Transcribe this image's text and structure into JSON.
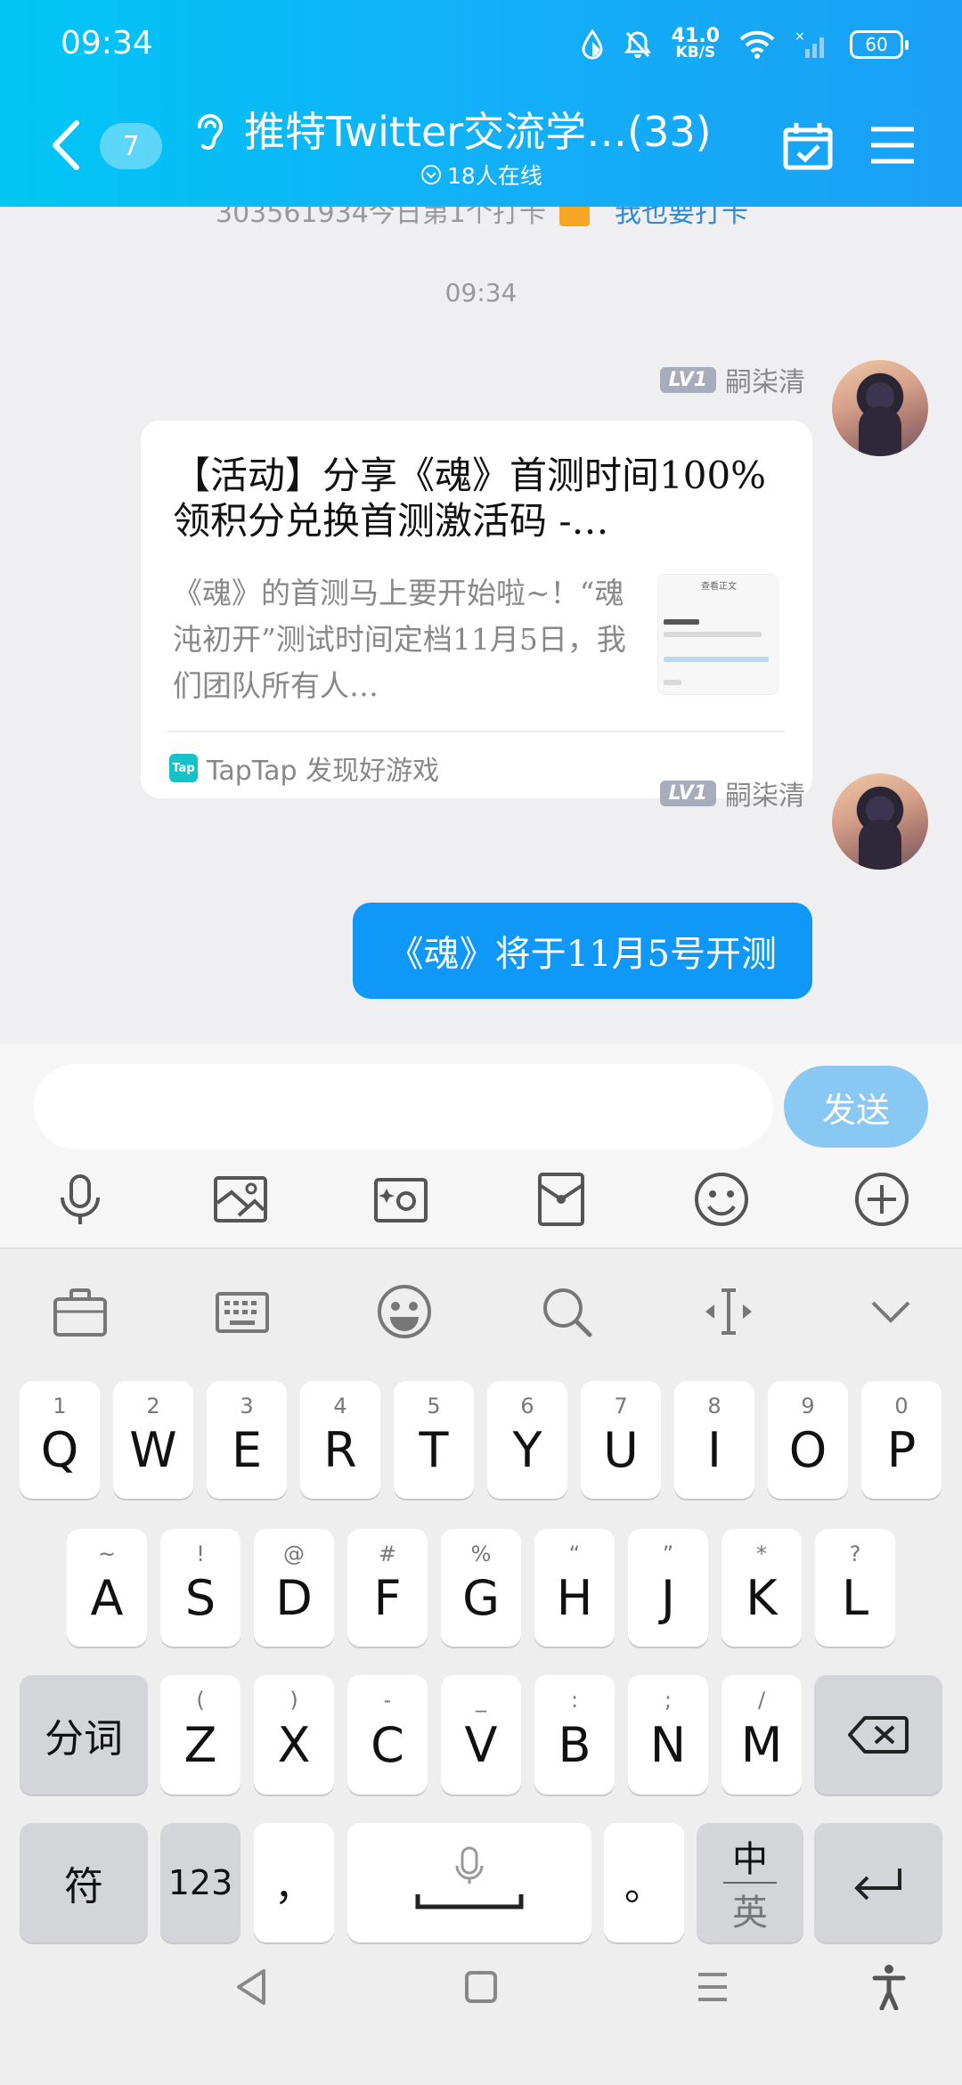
{
  "status_bar": {
    "time": "09:34",
    "speed_value": "41.0",
    "speed_unit": "KB/S",
    "battery": "60"
  },
  "header": {
    "unread_count": "7",
    "title": "推特Twitter交流学…(33)",
    "online": "18人在线"
  },
  "chat": {
    "system_line": {
      "text": "303561934今日第1个打卡",
      "link": "我也要打卡"
    },
    "timestamp": "09:34",
    "messages": [
      {
        "level": "LV1",
        "sender": "嗣柒清",
        "card": {
          "title": "【活动】分享《魂》首测时间100%领积分兑换首测激活码 -…",
          "description": "《魂》的首测马上要开始啦~！“魂沌初开”测试时间定档11月5日，我们团队所有人…",
          "thumb_title": "查看正文",
          "source_logo": "Tap",
          "source": "TapTap 发现好游戏"
        }
      },
      {
        "level": "LV1",
        "sender": "嗣柒清",
        "text": "《魂》将于11月5号开测"
      }
    ]
  },
  "input": {
    "placeholder": "",
    "send_label": "发送"
  },
  "keyboard": {
    "row1": [
      {
        "letter": "Q",
        "hint": "1"
      },
      {
        "letter": "W",
        "hint": "2"
      },
      {
        "letter": "E",
        "hint": "3"
      },
      {
        "letter": "R",
        "hint": "4"
      },
      {
        "letter": "T",
        "hint": "5"
      },
      {
        "letter": "Y",
        "hint": "6"
      },
      {
        "letter": "U",
        "hint": "7"
      },
      {
        "letter": "I",
        "hint": "8"
      },
      {
        "letter": "O",
        "hint": "9"
      },
      {
        "letter": "P",
        "hint": "0"
      }
    ],
    "row2": [
      {
        "letter": "A",
        "hint": "~"
      },
      {
        "letter": "S",
        "hint": "!"
      },
      {
        "letter": "D",
        "hint": "@"
      },
      {
        "letter": "F",
        "hint": "#"
      },
      {
        "letter": "G",
        "hint": "%"
      },
      {
        "letter": "H",
        "hint": "“"
      },
      {
        "letter": "J",
        "hint": "”"
      },
      {
        "letter": "K",
        "hint": "*"
      },
      {
        "letter": "L",
        "hint": "?"
      }
    ],
    "row3": [
      {
        "letter": "Z",
        "hint": "("
      },
      {
        "letter": "X",
        "hint": ")"
      },
      {
        "letter": "C",
        "hint": "-"
      },
      {
        "letter": "V",
        "hint": "_"
      },
      {
        "letter": "B",
        "hint": ":"
      },
      {
        "letter": "N",
        "hint": ";"
      },
      {
        "letter": "M",
        "hint": "/"
      }
    ],
    "segment_label": "分词",
    "symbol_label": "符",
    "numbers_label": "123",
    "comma_label": "，",
    "period_label": "。",
    "lang_top": "中",
    "lang_bottom": "英"
  }
}
